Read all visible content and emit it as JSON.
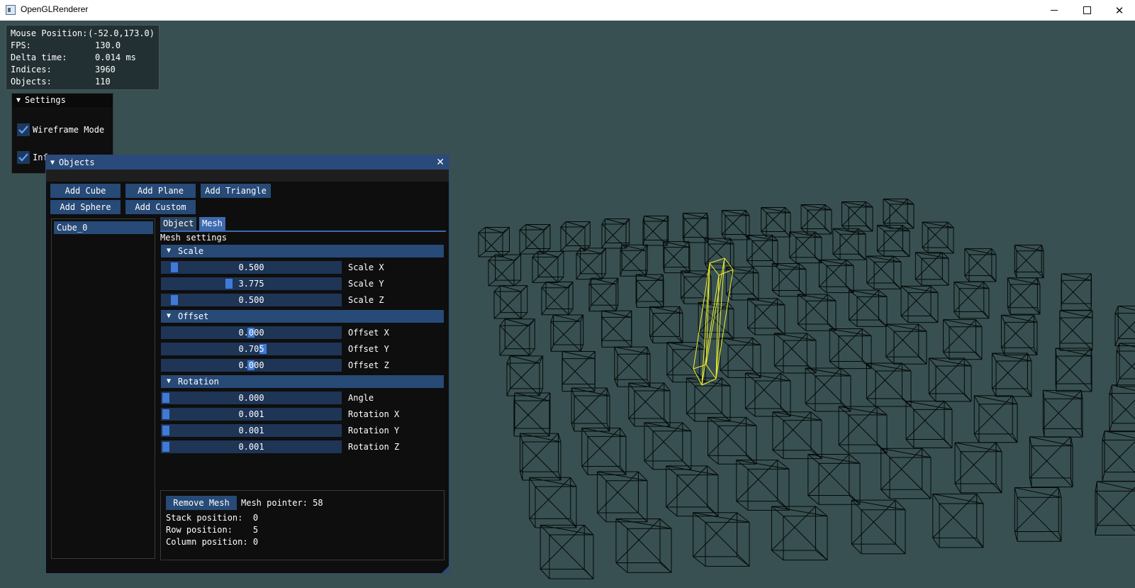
{
  "window": {
    "title": "OpenGLRenderer"
  },
  "overlay": {
    "rows": [
      {
        "label": "Mouse Position:",
        "value": "(-52.0,173.0)"
      },
      {
        "label": "FPS:",
        "value": "130.0"
      },
      {
        "label": "Delta time:",
        "value": "0.014 ms"
      },
      {
        "label": "Indices:",
        "value": "3960"
      },
      {
        "label": "Objects:",
        "value": "110"
      }
    ]
  },
  "settings": {
    "title": "Settings",
    "wireframe_label": "Wireframe Mode",
    "info_label": "Inf",
    "wireframe_checked": true,
    "info_checked": true
  },
  "objects": {
    "title": "Objects",
    "buttons": {
      "add_cube": "Add Cube",
      "add_plane": "Add Plane",
      "add_triangle": "Add Triangle",
      "add_sphere": "Add Sphere",
      "add_custom": "Add Custom"
    },
    "list": [
      "Cube_0"
    ],
    "tabs": [
      "Object",
      "Mesh"
    ],
    "active_tab": "Mesh",
    "section_label": "Mesh settings",
    "scale": {
      "header": "Scale",
      "x": {
        "value": "0.500",
        "label": "Scale X"
      },
      "y": {
        "value": "3.775",
        "label": "Scale Y"
      },
      "z": {
        "value": "0.500",
        "label": "Scale Z"
      }
    },
    "offset": {
      "header": "Offset",
      "x": {
        "value": "0.000",
        "label": "Offset X"
      },
      "y": {
        "value": "0.705",
        "label": "Offset Y"
      },
      "z": {
        "value": "0.000",
        "label": "Offset Z"
      }
    },
    "rotation": {
      "header": "Rotation",
      "angle": {
        "value": "0.000",
        "label": "Angle"
      },
      "x": {
        "value": "0.001",
        "label": "Rotation X"
      },
      "y": {
        "value": "0.001",
        "label": "Rotation Y"
      },
      "z": {
        "value": "0.001",
        "label": "Rotation Z"
      }
    },
    "remove_mesh": "Remove Mesh",
    "mesh_pointer": "Mesh pointer: 58",
    "stack_position": "Stack position:  0",
    "row_position": "Row position:    5",
    "column_position": "Column position: 0"
  },
  "colors": {
    "background": "#385051",
    "wire": "#050808",
    "selected": "#f2f22a",
    "accent": "#3f7ad6"
  }
}
